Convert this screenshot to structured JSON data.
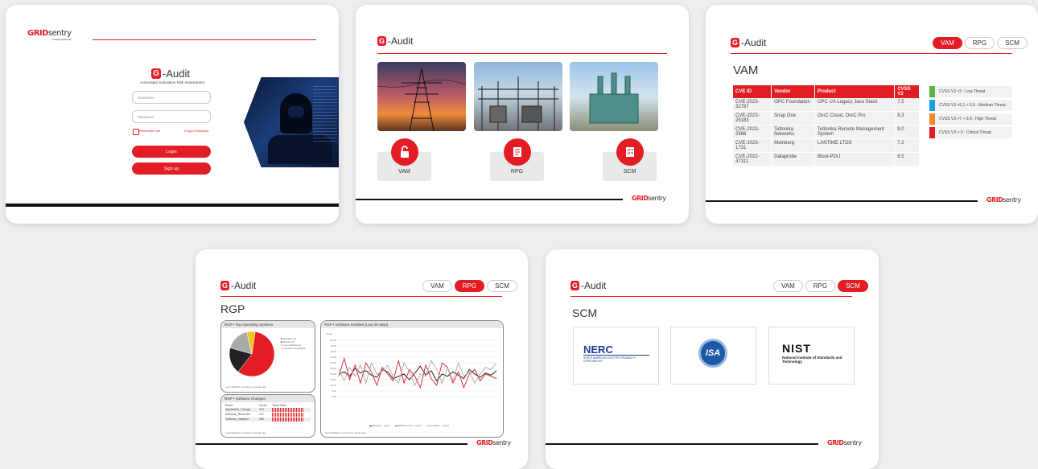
{
  "brand": {
    "grid": "GRID",
    "sentry": "sentry",
    "tagline": "Foresight Cybersecurity"
  },
  "gaudit": {
    "g": "G",
    "word": "-Audit"
  },
  "login": {
    "subtitle": "Automated Substation Risk Assessment",
    "username_placeholder": "Username",
    "password_placeholder": "Password",
    "remember": "Remember me",
    "forgot": "Forgot Password",
    "login_btn": "Login",
    "signup_btn": "Sign up"
  },
  "home": {
    "cards": [
      "VAM",
      "RPG",
      "SCM"
    ]
  },
  "tabs": [
    "VAM",
    "RPG",
    "SCM"
  ],
  "vam": {
    "heading": "VAM",
    "columns": [
      "CVE ID",
      "Vendor",
      "Product",
      "CVSS V3"
    ],
    "rows": [
      [
        "CVE-2023-32787",
        "OPC Foundation",
        "OPC UA Legacy Java Stack",
        "7,5"
      ],
      [
        "CVE-2023-25183",
        "Snap One",
        "OvrC Cloud, OvrC Pro",
        "8,3"
      ],
      [
        "CVE-2023-2586",
        "Teltonika Networks",
        "Teltonika Remote Management System",
        "9,0"
      ],
      [
        "CVE-2023-1731",
        "Meinberg",
        "LANTIME LTOS",
        "7,2"
      ],
      [
        "CVE-2022-47311",
        "Dataprobe",
        "iBoot-PDU",
        "8,5"
      ]
    ],
    "legend": [
      {
        "label": "CVSS V3 <5 : Low Threat",
        "color": "#5bb345"
      },
      {
        "label": "CVSS V3 >5,1 < 6,9 : Medium Threat",
        "color": "#1ba1e2"
      },
      {
        "label": "CVSS V3 >7 < 8,9 : High Threat",
        "color": "#f0862d"
      },
      {
        "label": "CVSS V3 > 9 : Critical Threat",
        "color": "#e31d25"
      }
    ]
  },
  "rpg": {
    "heading": "RGP",
    "pie_title": "RGP • Top Operating Systems",
    "pie_legend": [
      "Windows 10",
      "Windows 8",
      "Linux distribution",
      "Unknown compilation"
    ],
    "pie_footer": "Last Updated: Less than a minute ago",
    "changes_title": "RGP • Software Changes",
    "changes_cols": [
      "Event",
      "Count",
      "Trend Data"
    ],
    "changes_rows": [
      [
        "Application_Change",
        "324"
      ],
      [
        "Software_Removed",
        "147"
      ],
      [
        "Software_Installed",
        "365"
      ]
    ],
    "changes_footer": "Last Updated: Less than a minute ago",
    "line_title": "RGP • Software Installed (Last 30 days)",
    "line_footer": "Last Updated: Less than a minute ago",
    "line_legend": [
      "Windows - Count",
      "ZyWALL-OS.A - Count",
      "cumulative - Count"
    ],
    "line_y_label": "Count"
  },
  "scm": {
    "heading": "SCM",
    "logos": [
      {
        "main": "NERC",
        "sub": "NORTH AMERICAN ELECTRIC RELIABILITY CORPORATION"
      },
      {
        "main": "ISA",
        "sub": ""
      },
      {
        "main": "NIST",
        "sub": "National Institute of Standards and Technology"
      }
    ]
  },
  "chart_data": [
    {
      "type": "pie",
      "title": "RGP • Top Operating Systems",
      "categories": [
        "Windows 10",
        "Windows 8",
        "Linux distribution",
        "Unknown compilation"
      ],
      "values": [
        58,
        19,
        17,
        6
      ],
      "colors": [
        "#e31d25",
        "#222222",
        "#aaaaaa",
        "#f5c518"
      ]
    },
    {
      "type": "line",
      "title": "RGP • Software Installed (Last 30 days)",
      "ylim": [
        0,
        50
      ],
      "ylabel": "Count",
      "series": [
        {
          "name": "Windows - Count",
          "color": "#111111",
          "values": [
            20,
            22,
            18,
            25,
            21,
            23,
            19,
            17,
            24,
            22,
            16,
            18,
            20,
            15,
            21,
            27,
            19,
            23,
            14,
            20,
            18,
            22,
            19,
            16,
            24,
            20,
            17,
            21,
            19,
            23
          ]
        },
        {
          "name": "ZyWALL-OS.A - Count",
          "color": "#e31d25",
          "values": [
            18,
            34,
            15,
            28,
            12,
            30,
            22,
            10,
            26,
            20,
            14,
            32,
            12,
            24,
            18,
            8,
            28,
            16,
            10,
            30,
            26,
            12,
            22,
            8,
            20,
            24,
            14,
            20,
            18,
            16
          ]
        },
        {
          "name": "cumulative - Count",
          "color": "#aaaaaa",
          "values": [
            24,
            14,
            26,
            18,
            28,
            12,
            30,
            20,
            22,
            28,
            18,
            12,
            30,
            22,
            10,
            20,
            18,
            32,
            24,
            12,
            26,
            14,
            30,
            18,
            22,
            12,
            20,
            26,
            24,
            30
          ]
        }
      ]
    }
  ]
}
